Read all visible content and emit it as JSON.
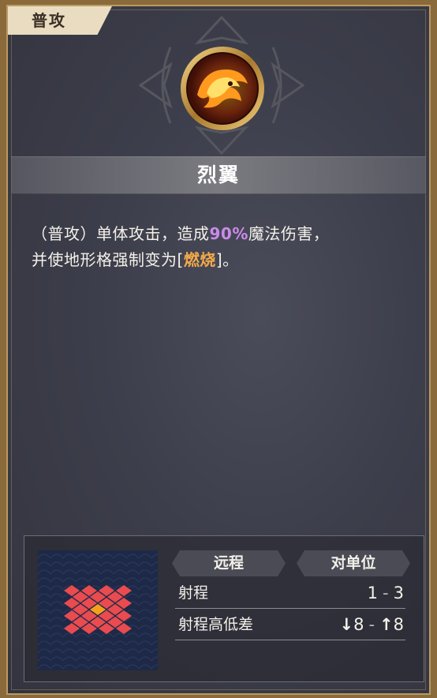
{
  "tab": {
    "label": "普攻"
  },
  "skill": {
    "name": "烈翼",
    "desc_line1_a": "（普攻）单体攻击，造成",
    "desc_pct": "90%",
    "desc_line1_b": "魔法伤害，",
    "desc_line2_a": "并使地形格强制变为[",
    "desc_status": "燃烧",
    "desc_line2_b": "]。",
    "icon": "fire-bird-icon"
  },
  "info": {
    "attack_type": "远程",
    "target_type": "对单位",
    "range_label": "射程",
    "range_min": "1",
    "range_sep": "-",
    "range_max": "3",
    "height_label": "射程高低差",
    "height_down_icon": "arrow-down-icon",
    "height_down": "8",
    "height_sep": "-",
    "height_up_icon": "arrow-up-icon",
    "height_up": "8"
  },
  "colors": {
    "pct": "#c98be8",
    "status": "#f2a94a",
    "range_tile": "#e94b4f",
    "center_tile": "#f5a01a",
    "grid_bg": "#1e2947"
  }
}
